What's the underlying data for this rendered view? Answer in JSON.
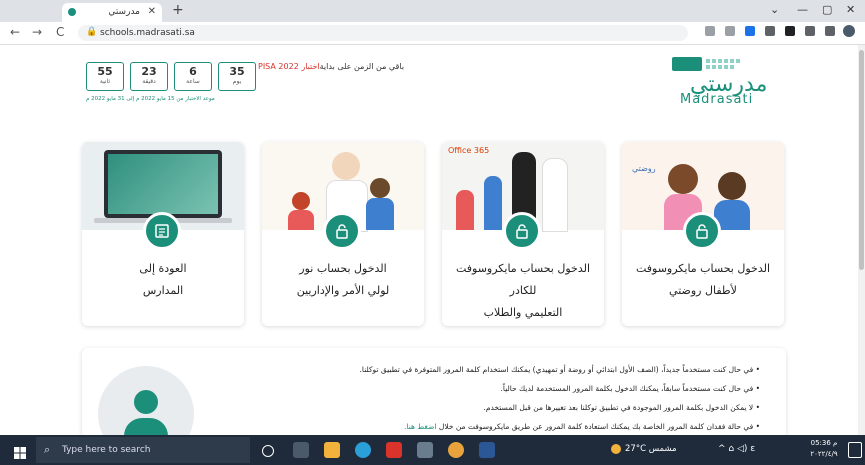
{
  "browser": {
    "tab_title": "مدرستي",
    "tab_close": "✕",
    "new_tab": "+",
    "url": "schools.madrasati.sa",
    "window_controls": [
      "⌄",
      "—",
      "▢",
      "✕"
    ],
    "nav": [
      "←",
      "→",
      "C"
    ]
  },
  "countdown": {
    "text_before": "باقي من الزمن على بداية",
    "highlight": "اختبار PISA 2022",
    "boxes": [
      {
        "value": "35",
        "unit": "يوم"
      },
      {
        "value": "6",
        "unit": "ساعة"
      },
      {
        "value": "23",
        "unit": "دقيقة"
      },
      {
        "value": "55",
        "unit": "ثانية"
      }
    ],
    "date_note": "موعد الاختبار من 15 مايو 2022 م إلى 31 مايو 2022 م"
  },
  "logo": {
    "arabic": "مدرستي",
    "latin": "Madrasati"
  },
  "cards": [
    {
      "line1": "العودة إلى",
      "line2": "المدارس",
      "icon": "list-icon"
    },
    {
      "line1": "الدخول بحساب نور",
      "line2": "لولي الأمر والإداريين",
      "icon": "lock-icon"
    },
    {
      "line1": "الدخول بحساب مايكروسوفت للكادر",
      "line2": "التعليمي والطلاب",
      "icon": "lock-icon"
    },
    {
      "line1": "الدخول بحساب مايكروسوفت",
      "line2": "لأطفال روضتي",
      "icon": "lock-icon"
    }
  ],
  "card_image_labels": {
    "office": "Office 365",
    "rawdati": "روضتي"
  },
  "info": {
    "bullets": [
      "في حال كنت مستخدماً جديداً، (الصف الأول ابتدائي أو روضة أو تمهيدي) يمكنك استخدام كلمة المرور المتوفرة في تطبيق توكلنا.",
      "في حال كنت مستخدماً سابقاً، يمكنك الدخول بكلمة المرور المستخدمة لديك حالياً.",
      "لا يمكن الدخول بكلمة المرور الموجودة في تطبيق توكلنا بعد تغييرها من قبل المستخدم.",
      "في حالة فقدان كلمة المرور الخاصة بك يمكنك استعادة كلمة المرور عن طريق مايكروسوفت من خلال"
    ],
    "link": "اضغط هنا."
  },
  "taskbar": {
    "search_placeholder": "Type here to search",
    "weather": "27°C  مشمس",
    "time": "05:36 م",
    "date": "٢٠٢٢/٤/٩"
  },
  "colors": {
    "brand": "#1c8f7b",
    "accent": "#d9332b",
    "taskbar": "#1f2b3a"
  }
}
